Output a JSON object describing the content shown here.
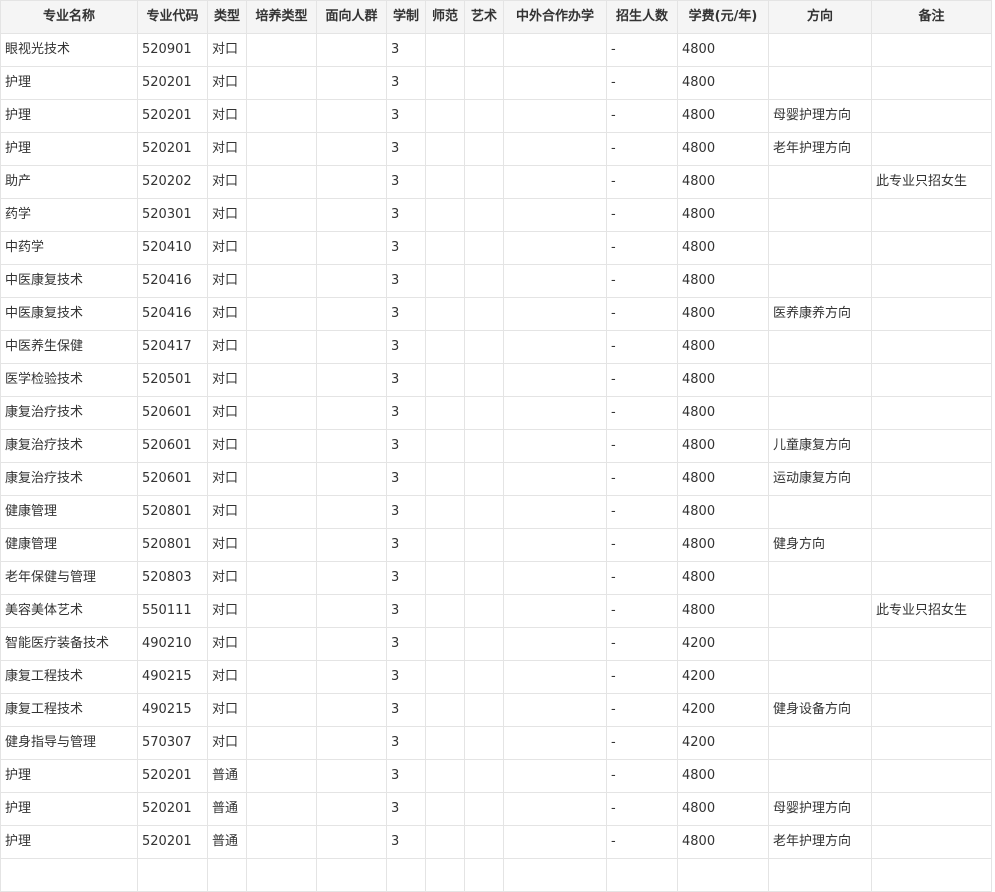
{
  "headers": [
    "专业名称",
    "专业代码",
    "类型",
    "培养类型",
    "面向人群",
    "学制",
    "师范",
    "艺术",
    "中外合作办学",
    "招生人数",
    "学费(元/年)",
    "方向",
    "备注"
  ],
  "rows": [
    [
      "眼视光技术",
      "520901",
      "对口",
      "",
      "",
      "3",
      "",
      "",
      "",
      "-",
      "4800",
      "",
      ""
    ],
    [
      "护理",
      "520201",
      "对口",
      "",
      "",
      "3",
      "",
      "",
      "",
      "-",
      "4800",
      "",
      ""
    ],
    [
      "护理",
      "520201",
      "对口",
      "",
      "",
      "3",
      "",
      "",
      "",
      "-",
      "4800",
      "母婴护理方向",
      ""
    ],
    [
      "护理",
      "520201",
      "对口",
      "",
      "",
      "3",
      "",
      "",
      "",
      "-",
      "4800",
      "老年护理方向",
      ""
    ],
    [
      "助产",
      "520202",
      "对口",
      "",
      "",
      "3",
      "",
      "",
      "",
      "-",
      "4800",
      "",
      "此专业只招女生"
    ],
    [
      "药学",
      "520301",
      "对口",
      "",
      "",
      "3",
      "",
      "",
      "",
      "-",
      "4800",
      "",
      ""
    ],
    [
      "中药学",
      "520410",
      "对口",
      "",
      "",
      "3",
      "",
      "",
      "",
      "-",
      "4800",
      "",
      ""
    ],
    [
      "中医康复技术",
      "520416",
      "对口",
      "",
      "",
      "3",
      "",
      "",
      "",
      "-",
      "4800",
      "",
      ""
    ],
    [
      "中医康复技术",
      "520416",
      "对口",
      "",
      "",
      "3",
      "",
      "",
      "",
      "-",
      "4800",
      "医养康养方向",
      ""
    ],
    [
      "中医养生保健",
      "520417",
      "对口",
      "",
      "",
      "3",
      "",
      "",
      "",
      "-",
      "4800",
      "",
      ""
    ],
    [
      "医学检验技术",
      "520501",
      "对口",
      "",
      "",
      "3",
      "",
      "",
      "",
      "-",
      "4800",
      "",
      ""
    ],
    [
      "康复治疗技术",
      "520601",
      "对口",
      "",
      "",
      "3",
      "",
      "",
      "",
      "-",
      "4800",
      "",
      ""
    ],
    [
      "康复治疗技术",
      "520601",
      "对口",
      "",
      "",
      "3",
      "",
      "",
      "",
      "-",
      "4800",
      "儿童康复方向",
      ""
    ],
    [
      "康复治疗技术",
      "520601",
      "对口",
      "",
      "",
      "3",
      "",
      "",
      "",
      "-",
      "4800",
      "运动康复方向",
      ""
    ],
    [
      "健康管理",
      "520801",
      "对口",
      "",
      "",
      "3",
      "",
      "",
      "",
      "-",
      "4800",
      "",
      ""
    ],
    [
      "健康管理",
      "520801",
      "对口",
      "",
      "",
      "3",
      "",
      "",
      "",
      "-",
      "4800",
      "健身方向",
      ""
    ],
    [
      "老年保健与管理",
      "520803",
      "对口",
      "",
      "",
      "3",
      "",
      "",
      "",
      "-",
      "4800",
      "",
      ""
    ],
    [
      "美容美体艺术",
      "550111",
      "对口",
      "",
      "",
      "3",
      "",
      "",
      "",
      "-",
      "4800",
      "",
      "此专业只招女生"
    ],
    [
      "智能医疗装备技术",
      "490210",
      "对口",
      "",
      "",
      "3",
      "",
      "",
      "",
      "-",
      "4200",
      "",
      ""
    ],
    [
      "康复工程技术",
      "490215",
      "对口",
      "",
      "",
      "3",
      "",
      "",
      "",
      "-",
      "4200",
      "",
      ""
    ],
    [
      "康复工程技术",
      "490215",
      "对口",
      "",
      "",
      "3",
      "",
      "",
      "",
      "-",
      "4200",
      "健身设备方向",
      ""
    ],
    [
      "健身指导与管理",
      "570307",
      "对口",
      "",
      "",
      "3",
      "",
      "",
      "",
      "-",
      "4200",
      "",
      ""
    ],
    [
      "护理",
      "520201",
      "普通",
      "",
      "",
      "3",
      "",
      "",
      "",
      "-",
      "4800",
      "",
      ""
    ],
    [
      "护理",
      "520201",
      "普通",
      "",
      "",
      "3",
      "",
      "",
      "",
      "-",
      "4800",
      "母婴护理方向",
      ""
    ],
    [
      "护理",
      "520201",
      "普通",
      "",
      "",
      "3",
      "",
      "",
      "",
      "-",
      "4800",
      "老年护理方向",
      ""
    ],
    [
      "",
      "",
      "",
      "",
      "",
      "",
      "",
      "",
      "",
      "",
      "",
      "",
      ""
    ]
  ]
}
